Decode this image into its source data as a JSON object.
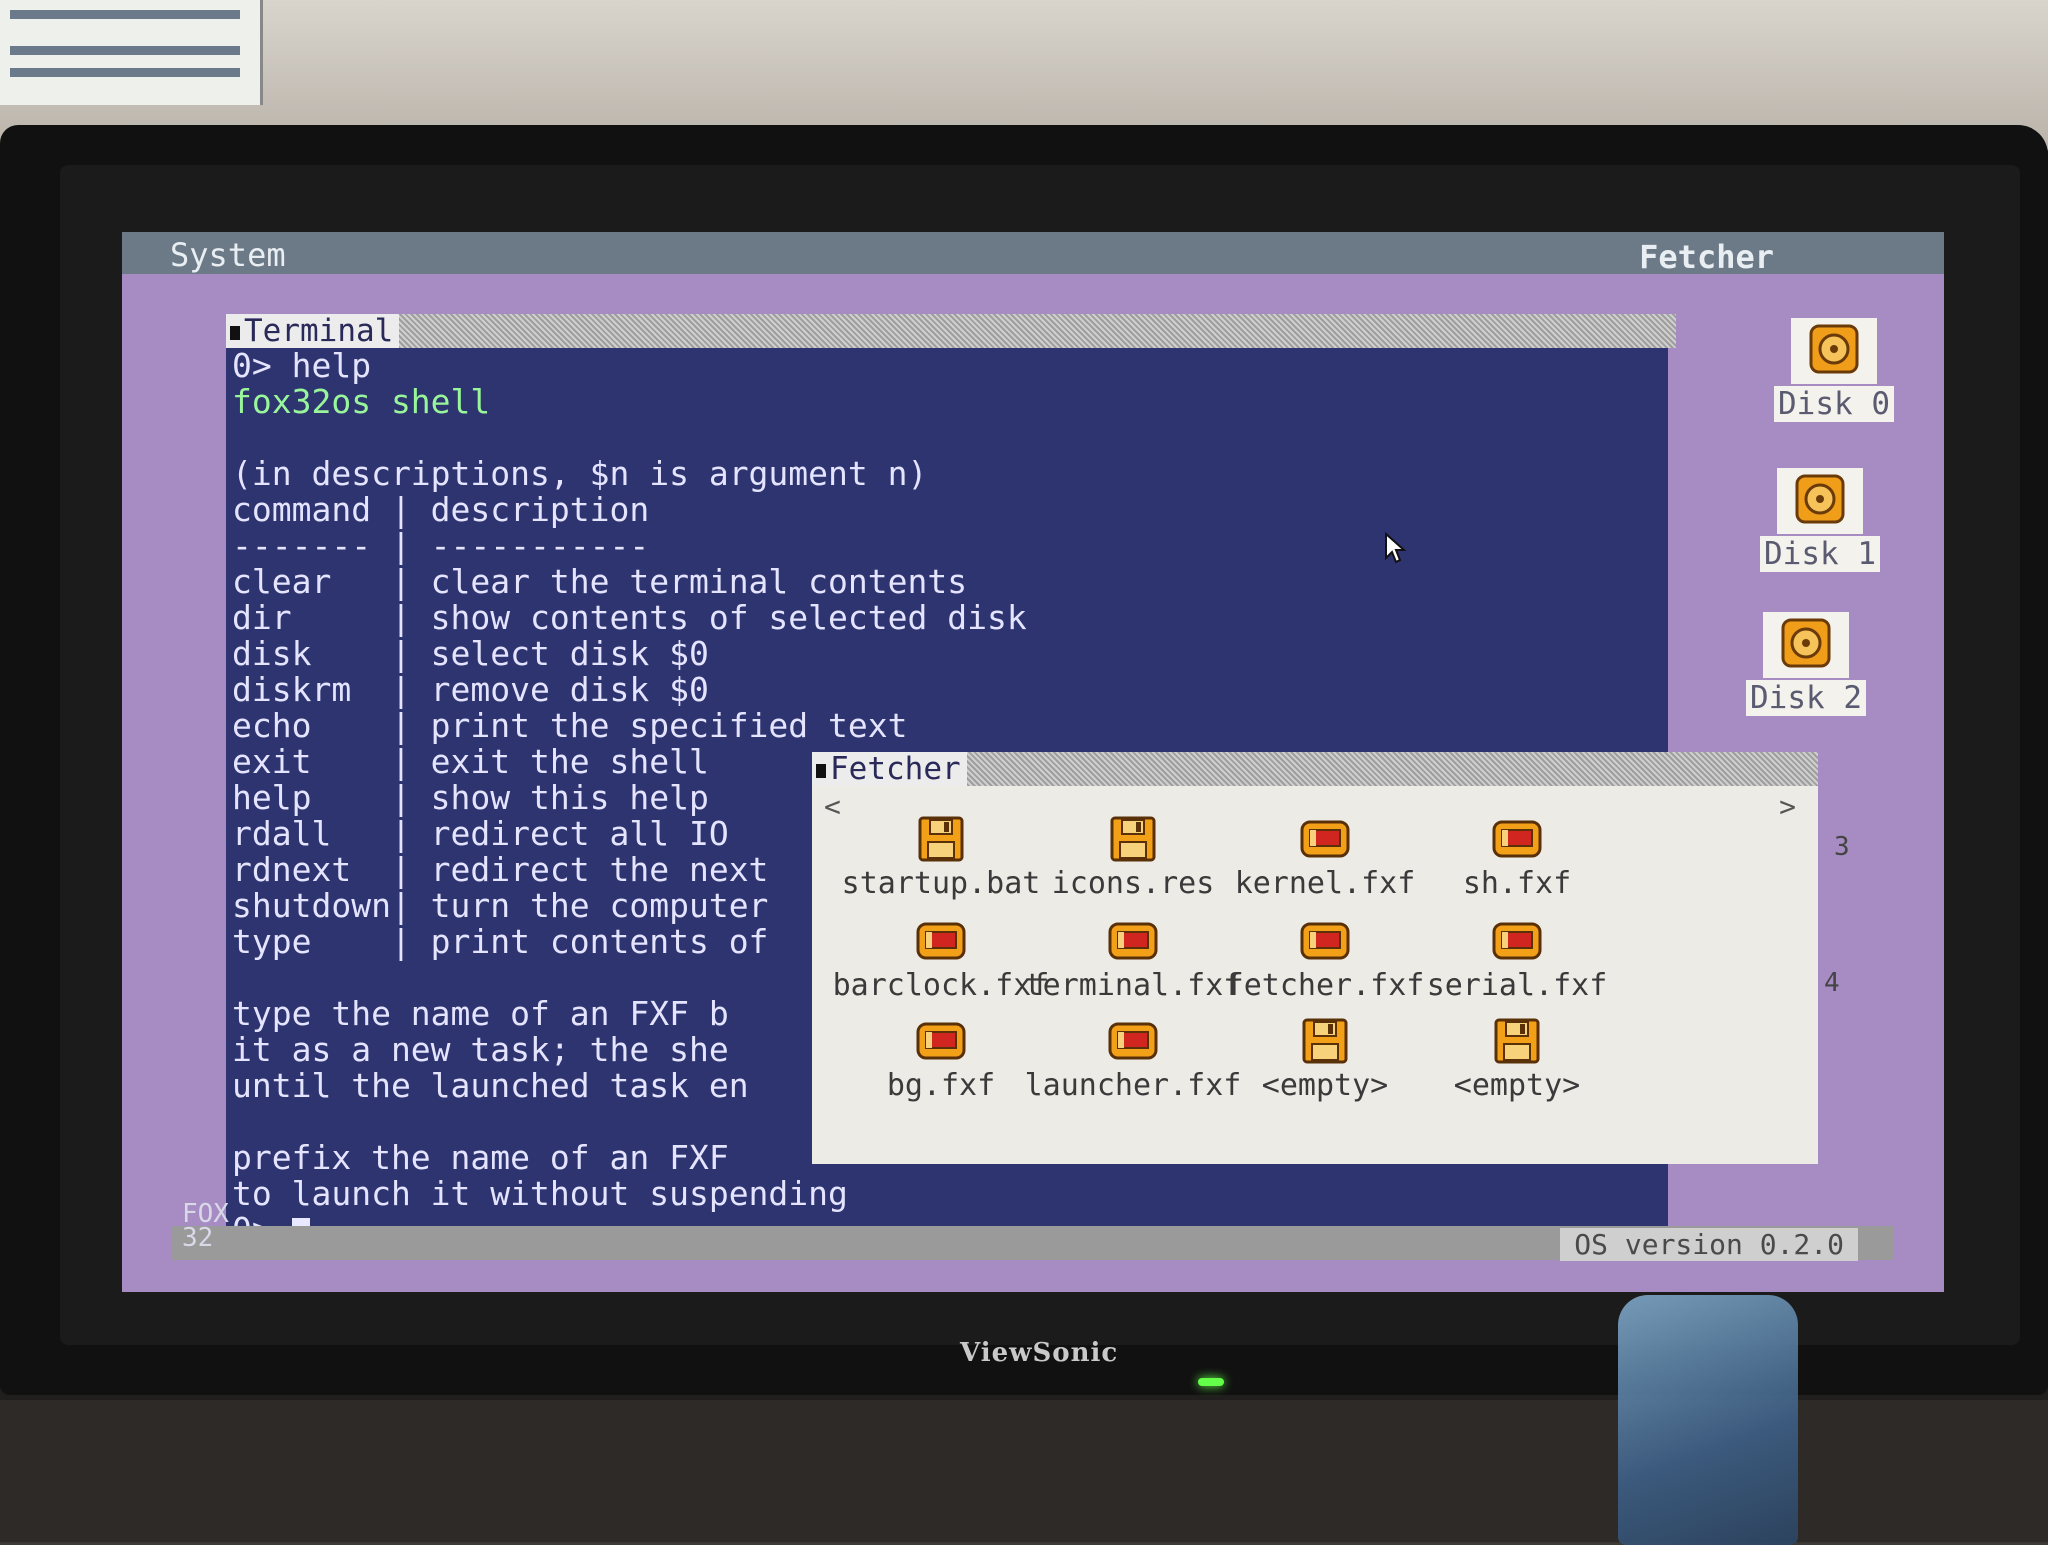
{
  "menubar": {
    "left": "System",
    "right": "Fetcher"
  },
  "terminal": {
    "title": "Terminal",
    "lines": [
      {
        "text": "0> help",
        "color": "#e4e4ff"
      },
      {
        "text": "fox32os shell",
        "color": "#98f59a"
      },
      {
        "text": "",
        "color": "#e4e4ff"
      },
      {
        "text": "(in descriptions, $n is argument n)",
        "color": "#e4e4ff"
      },
      {
        "text": "command | description",
        "color": "#e4e4ff"
      },
      {
        "text": "------- | -----------",
        "color": "#e4e4ff"
      },
      {
        "text": "clear   | clear the terminal contents",
        "color": "#e4e4ff"
      },
      {
        "text": "dir     | show contents of selected disk",
        "color": "#e4e4ff"
      },
      {
        "text": "disk    | select disk $0",
        "color": "#e4e4ff"
      },
      {
        "text": "diskrm  | remove disk $0",
        "color": "#e4e4ff"
      },
      {
        "text": "echo    | print the specified text",
        "color": "#e4e4ff"
      },
      {
        "text": "exit    | exit the shell",
        "color": "#e4e4ff"
      },
      {
        "text": "help    | show this help",
        "color": "#e4e4ff"
      },
      {
        "text": "rdall   | redirect all IO",
        "color": "#e4e4ff"
      },
      {
        "text": "rdnext  | redirect the next",
        "color": "#e4e4ff"
      },
      {
        "text": "shutdown| turn the computer",
        "color": "#e4e4ff"
      },
      {
        "text": "type    | print contents of",
        "color": "#e4e4ff"
      },
      {
        "text": "",
        "color": "#e4e4ff"
      },
      {
        "text": "type the name of an FXF b",
        "color": "#e4e4ff"
      },
      {
        "text": "it as a new task; the she",
        "color": "#e4e4ff"
      },
      {
        "text": "until the launched task en",
        "color": "#e4e4ff"
      },
      {
        "text": "",
        "color": "#e4e4ff"
      },
      {
        "text": "prefix the name of an FXF",
        "color": "#e4e4ff"
      },
      {
        "text": "to launch it without suspending",
        "color": "#e4e4ff"
      }
    ],
    "prompt": "0>"
  },
  "fetcher": {
    "title": "Fetcher",
    "prev": "<",
    "next": ">",
    "files": [
      {
        "name": "startup.bat",
        "icon": "floppy-icon"
      },
      {
        "name": "icons.res",
        "icon": "floppy-icon"
      },
      {
        "name": "kernel.fxf",
        "icon": "executable-icon"
      },
      {
        "name": "sh.fxf",
        "icon": "executable-icon"
      },
      {
        "name": "barclock.fxf",
        "icon": "executable-icon"
      },
      {
        "name": "terminal.fxf",
        "icon": "executable-icon"
      },
      {
        "name": "fetcher.fxf",
        "icon": "executable-icon"
      },
      {
        "name": "serial.fxf",
        "icon": "executable-icon"
      },
      {
        "name": "bg.fxf",
        "icon": "executable-icon"
      },
      {
        "name": "launcher.fxf",
        "icon": "executable-icon"
      },
      {
        "name": "<empty>",
        "icon": "floppy-icon"
      },
      {
        "name": "<empty>",
        "icon": "floppy-icon"
      }
    ]
  },
  "disks": [
    {
      "label": "Disk 0"
    },
    {
      "label": "Disk 1"
    },
    {
      "label": "Disk 2"
    }
  ],
  "side_numbers": [
    "3",
    "4"
  ],
  "bottom": {
    "logo_top": "FOX",
    "logo_bottom": "32",
    "version": "OS version 0.2.0"
  },
  "monitor": {
    "brand": "ViewSonic"
  },
  "colors": {
    "desktop": "#a68cc2",
    "terminal_bg": "#2e3470",
    "terminal_text": "#e4e4ff",
    "terminal_green": "#98f59a",
    "menubar": "#6c7a88",
    "fetcher_bg": "#ecebe6",
    "icon_orange": "#f2a018"
  }
}
